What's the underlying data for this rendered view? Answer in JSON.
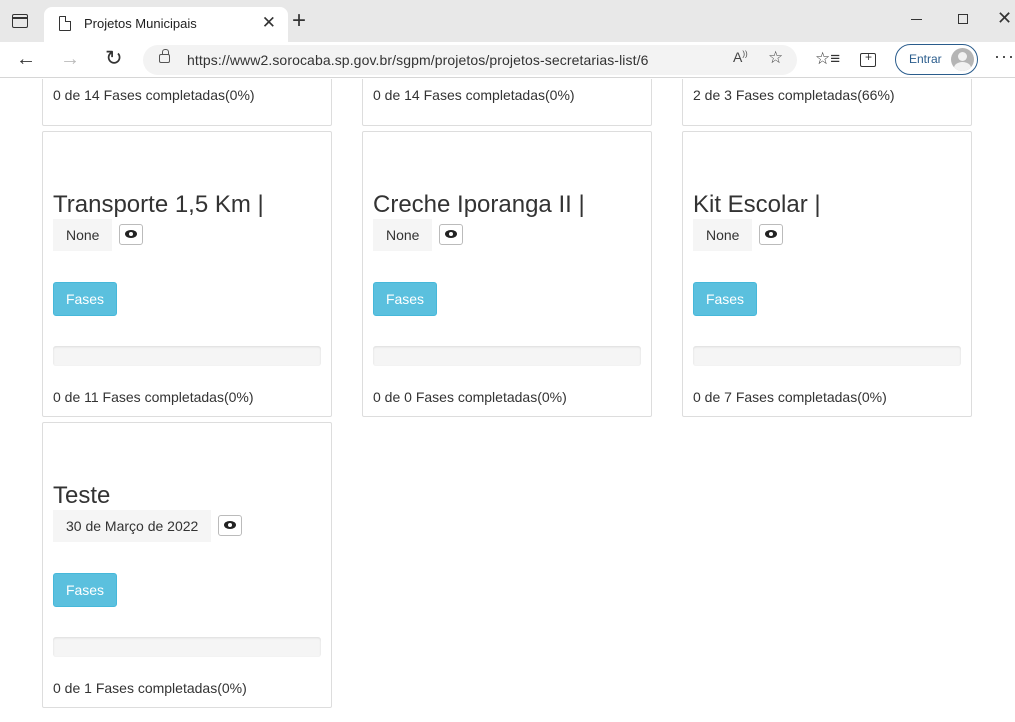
{
  "browser": {
    "tab_title": "Projetos Municipais",
    "url": "https://www2.sorocaba.sp.gov.br/sgpm/projetos/projetos-secretarias-list/6",
    "signin_label": "Entrar"
  },
  "partial_cards": [
    {
      "progress_text": "0 de 14 Fases completadas(0%)"
    },
    {
      "progress_text": "0 de 14 Fases completadas(0%)"
    },
    {
      "progress_text": "2 de 3 Fases completadas(66%)"
    }
  ],
  "cards": [
    {
      "title": "Transporte 1,5 Km |",
      "date": "None",
      "button": "Fases",
      "progress": 0,
      "progress_text": "0 de 11 Fases completadas(0%)"
    },
    {
      "title": "Creche Iporanga II |",
      "date": "None",
      "button": "Fases",
      "progress": 0,
      "progress_text": "0 de 0 Fases completadas(0%)"
    },
    {
      "title": "Kit Escolar |",
      "date": "None",
      "button": "Fases",
      "progress": 0,
      "progress_text": "0 de 7 Fases completadas(0%)"
    },
    {
      "title": "Teste",
      "date": "30 de Março de 2022",
      "button": "Fases",
      "progress": 0,
      "progress_text": "0 de 1 Fases completadas(0%)"
    }
  ]
}
